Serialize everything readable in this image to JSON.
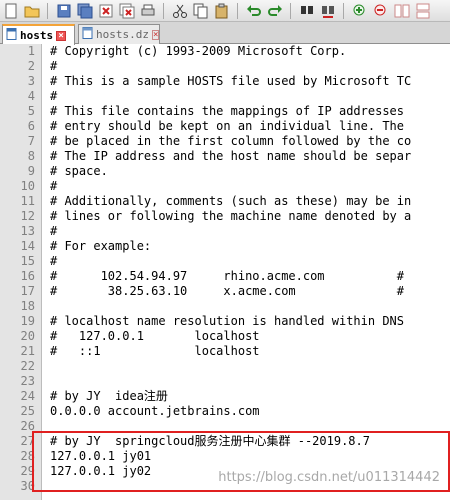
{
  "toolbar": {
    "icons": [
      "new-file-icon",
      "open-file-icon",
      "save-icon",
      "save-all-icon",
      "close-icon",
      "close-all-icon",
      "print-icon",
      "cut-icon",
      "copy-icon",
      "paste-icon",
      "undo-icon",
      "redo-icon",
      "find-icon",
      "replace-icon",
      "zoom-in-icon",
      "zoom-out-icon",
      "sync-v-icon",
      "sync-h-icon"
    ]
  },
  "tabs": [
    {
      "label": "hosts",
      "active": true
    },
    {
      "label": "hosts.dz",
      "active": false
    }
  ],
  "lines": [
    {
      "num": "1",
      "text": "# Copyright (c) 1993-2009 Microsoft Corp."
    },
    {
      "num": "2",
      "text": "#"
    },
    {
      "num": "3",
      "text": "# This is a sample HOSTS file used by Microsoft TC"
    },
    {
      "num": "4",
      "text": "#"
    },
    {
      "num": "5",
      "text": "# This file contains the mappings of IP addresses"
    },
    {
      "num": "6",
      "text": "# entry should be kept on an individual line. The"
    },
    {
      "num": "7",
      "text": "# be placed in the first column followed by the co"
    },
    {
      "num": "8",
      "text": "# The IP address and the host name should be separ"
    },
    {
      "num": "9",
      "text": "# space."
    },
    {
      "num": "10",
      "text": "#"
    },
    {
      "num": "11",
      "text": "# Additionally, comments (such as these) may be in"
    },
    {
      "num": "12",
      "text": "# lines or following the machine name denoted by a"
    },
    {
      "num": "13",
      "text": "#"
    },
    {
      "num": "14",
      "text": "# For example:"
    },
    {
      "num": "15",
      "text": "#"
    },
    {
      "num": "16",
      "text": "#      102.54.94.97     rhino.acme.com          #"
    },
    {
      "num": "17",
      "text": "#       38.25.63.10     x.acme.com              #"
    },
    {
      "num": "18",
      "text": ""
    },
    {
      "num": "19",
      "text": "# localhost name resolution is handled within DNS"
    },
    {
      "num": "20",
      "text": "#   127.0.0.1       localhost"
    },
    {
      "num": "21",
      "text": "#   ::1             localhost"
    },
    {
      "num": "22",
      "text": ""
    },
    {
      "num": "23",
      "text": ""
    },
    {
      "num": "24",
      "text": "# by JY  idea注册"
    },
    {
      "num": "25",
      "text": "0.0.0.0 account.jetbrains.com"
    },
    {
      "num": "26",
      "text": ""
    },
    {
      "num": "27",
      "text": "# by JY  springcloud服务注册中心集群 --2019.8.7"
    },
    {
      "num": "28",
      "text": "127.0.0.1 jy01"
    },
    {
      "num": "29",
      "text": "127.0.0.1 jy02"
    },
    {
      "num": "30",
      "text": ""
    }
  ],
  "watermark": "https://blog.csdn.net/u011314442"
}
